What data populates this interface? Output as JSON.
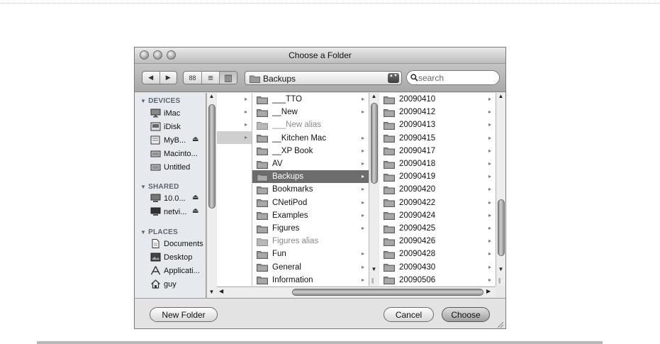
{
  "window": {
    "title": "Choose a Folder"
  },
  "toolbar": {
    "back_glyph": "◀",
    "forward_glyph": "▶",
    "view_icon_glyph": "88",
    "view_list_glyph": "≡",
    "view_column_glyph": "▥",
    "location_popup_value": "Backups",
    "popup_arrows_glyph": "▲▼",
    "search_placeholder": "search"
  },
  "sidebar": {
    "sections": [
      {
        "label": "DEVICES",
        "items": [
          {
            "label": "iMac",
            "icon": "computer-icon"
          },
          {
            "label": "iDisk",
            "icon": "idisk-icon"
          },
          {
            "label": "MyB...",
            "icon": "external-drive-icon",
            "eject": "⏏"
          },
          {
            "label": "Macinto...",
            "icon": "hard-drive-icon"
          },
          {
            "label": "Untitled",
            "icon": "hard-drive-icon"
          }
        ]
      },
      {
        "label": "SHARED",
        "items": [
          {
            "label": "10.0...",
            "icon": "network-computer-icon",
            "eject": "⏏"
          },
          {
            "label": "netvi...",
            "icon": "network-computer-icon",
            "eject": "⏏"
          }
        ]
      },
      {
        "label": "PLACES",
        "items": [
          {
            "label": "Documents",
            "icon": "document-icon"
          },
          {
            "label": "Desktop",
            "icon": "desktop-icon"
          },
          {
            "label": "Applicati...",
            "icon": "applications-icon"
          },
          {
            "label": "guy",
            "icon": "home-icon"
          }
        ]
      }
    ]
  },
  "columns": {
    "first_chevron": "▸",
    "folders": [
      {
        "label": "___TTO",
        "state": "normal"
      },
      {
        "label": "__New",
        "state": "normal"
      },
      {
        "label": "___New alias",
        "state": "alias"
      },
      {
        "label": "__Kitchen Mac",
        "state": "normal"
      },
      {
        "label": "__XP Book",
        "state": "normal"
      },
      {
        "label": "AV",
        "state": "normal"
      },
      {
        "label": "Backups",
        "state": "selected"
      },
      {
        "label": "Bookmarks",
        "state": "normal"
      },
      {
        "label": "CNetiPod",
        "state": "normal"
      },
      {
        "label": "Examples",
        "state": "normal"
      },
      {
        "label": "Figures",
        "state": "normal"
      },
      {
        "label": "Figures alias",
        "state": "alias"
      },
      {
        "label": "Fun",
        "state": "normal"
      },
      {
        "label": "General",
        "state": "normal"
      },
      {
        "label": "Information",
        "state": "normal"
      }
    ],
    "backups": [
      "20090410",
      "20090412",
      "20090413",
      "20090415",
      "20090417",
      "20090418",
      "20090419",
      "20090420",
      "20090422",
      "20090424",
      "20090425",
      "20090426",
      "20090428",
      "20090430",
      "20090506"
    ]
  },
  "buttons": {
    "new_folder": "New Folder",
    "cancel": "Cancel",
    "choose": "Choose"
  },
  "colors": {
    "selection": "#6d6d6d",
    "window_chrome": "#bdbdbd",
    "sidebar_bg": "#e6e9ee"
  }
}
